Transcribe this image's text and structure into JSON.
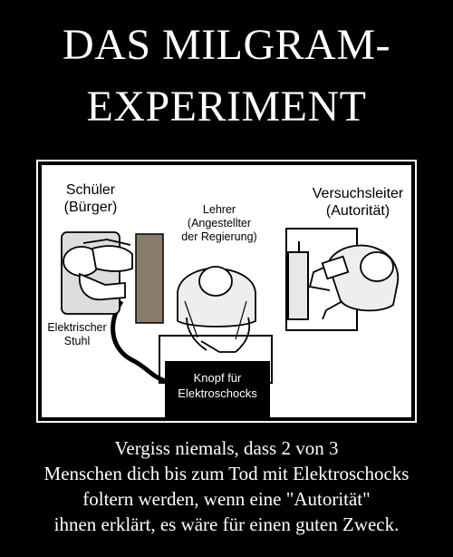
{
  "title": {
    "line1": "DAS MILGRAM-",
    "line2": "EXPERIMENT"
  },
  "diagram": {
    "schueler": {
      "line1": "Schüler",
      "line2": "(Bürger)"
    },
    "lehrer": {
      "line1": "Lehrer",
      "line2": "(Angestellter",
      "line3": "der Regierung)"
    },
    "versuchsleiter": {
      "line1": "Versuchsleiter",
      "line2": "(Autorität)"
    },
    "stuhl": {
      "line1": "Elektrischer",
      "line2": "Stuhl"
    },
    "knopf": {
      "line1": "Knopf für",
      "line2": "Elektroschocks"
    }
  },
  "caption": {
    "line1": "Vergiss niemals, dass 2 von 3",
    "line2": "Menschen dich bis zum Tod mit Elektroschocks",
    "line3": "foltern werden, wenn eine \"Autorität\"",
    "line4": "ihnen erklärt, es wäre für einen guten Zweck."
  }
}
